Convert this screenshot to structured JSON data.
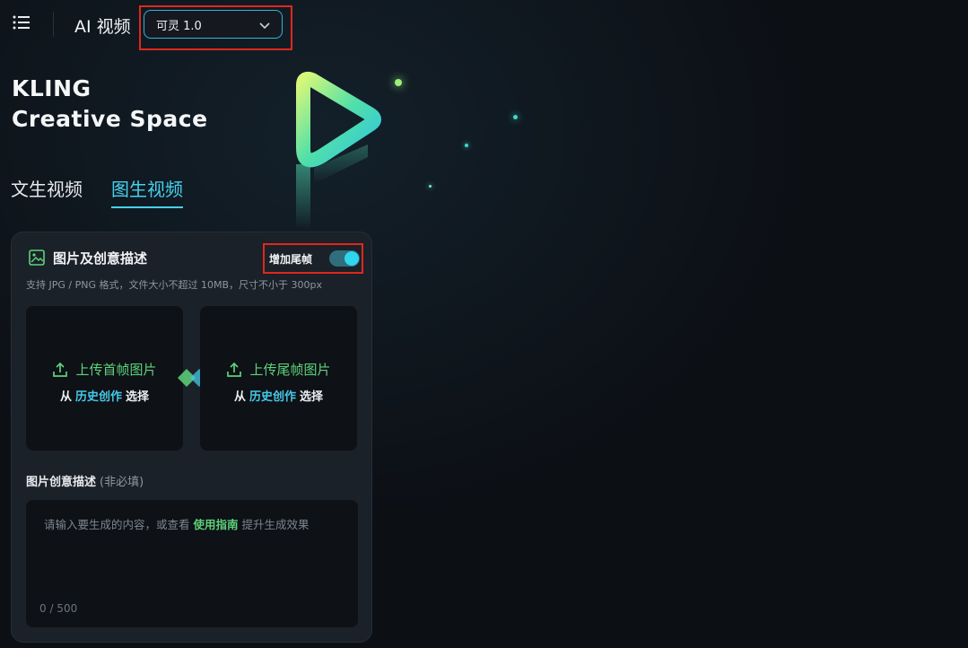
{
  "header": {
    "app_title": "AI 视频",
    "model_select": {
      "value": "可灵 1.0"
    }
  },
  "brand": {
    "line1": "KLING",
    "line2": "Creative Space"
  },
  "tabs": [
    {
      "label": "文生视频",
      "active": false
    },
    {
      "label": "图生视频",
      "active": true
    }
  ],
  "panel": {
    "section_title": "图片及创意描述",
    "toggle": {
      "label": "增加尾帧",
      "on": true
    },
    "hint": "支持 JPG / PNG 格式，文件大小不超过 10MB，尺寸不小于 300px",
    "upload_first": {
      "label": "上传首帧图片",
      "from": "从",
      "history_link": "历史创作",
      "choose": "选择"
    },
    "upload_last": {
      "label": "上传尾帧图片",
      "from": "从",
      "history_link": "历史创作",
      "choose": "选择"
    },
    "description": {
      "title": "图片创意描述",
      "optional": "(非必填)",
      "placeholder_before": "请输入要生成的内容，或查看",
      "guide_link": "使用指南",
      "placeholder_after": "提升生成效果",
      "counter": "0 / 500"
    }
  },
  "colors": {
    "accent_cyan": "#45d1ee",
    "accent_green": "#5ed27a",
    "highlight_red": "#e0271e"
  }
}
